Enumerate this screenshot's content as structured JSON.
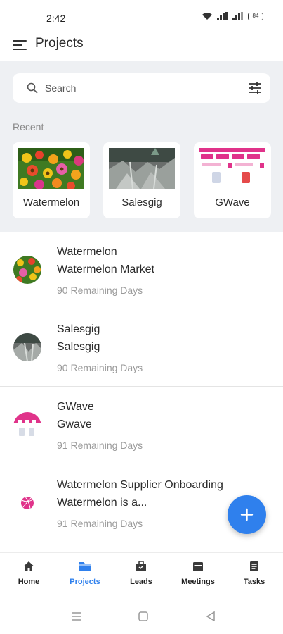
{
  "status_bar": {
    "time": "2:42",
    "battery": "84"
  },
  "app_bar": {
    "title": "Projects",
    "menu_icon": "menu-icon"
  },
  "search": {
    "placeholder": "Search",
    "icon": "search-icon",
    "filter_icon": "filter-icon"
  },
  "recent": {
    "label": "Recent",
    "cards": [
      {
        "name": "Watermelon",
        "thumb": "flowers"
      },
      {
        "name": "Salesgig",
        "thumb": "rocks"
      },
      {
        "name": "GWave",
        "thumb": "app-screens"
      }
    ]
  },
  "projects": [
    {
      "title": "Watermelon",
      "subtitle": "Watermelon Market",
      "days": "90 Remaining Days",
      "avatar": "flowers"
    },
    {
      "title": "Salesgig",
      "subtitle": "Salesgig",
      "days": "90 Remaining Days",
      "avatar": "rocks"
    },
    {
      "title": "GWave",
      "subtitle": "Gwave",
      "days": "91 Remaining Days",
      "avatar": "app-screens"
    },
    {
      "title": "Watermelon Supplier Onboarding",
      "subtitle": "Watermelon is a...",
      "days": "91 Remaining Days",
      "avatar": "dribbble-logo"
    }
  ],
  "fab": {
    "icon": "plus-icon"
  },
  "bottom_nav": [
    {
      "label": "Home",
      "icon": "home-icon",
      "active": false
    },
    {
      "label": "Projects",
      "icon": "folder-icon",
      "active": true
    },
    {
      "label": "Leads",
      "icon": "briefcase-icon",
      "active": false
    },
    {
      "label": "Meetings",
      "icon": "calendar-icon",
      "active": false
    },
    {
      "label": "Tasks",
      "icon": "document-icon",
      "active": false
    }
  ],
  "colors": {
    "accent": "#2f80ed",
    "panel_bg": "#eef0f3",
    "muted_text": "#9a9a9a",
    "gwave_pink": "#e0338a"
  }
}
